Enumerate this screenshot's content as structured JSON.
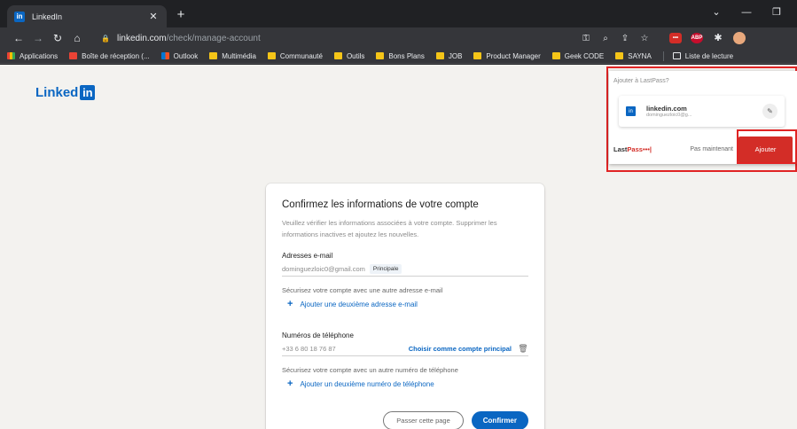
{
  "browser": {
    "tab_title": "LinkedIn",
    "tab_favicon": "in",
    "new_tab_symbol": "+",
    "url_host": "linkedin.com",
    "url_path": "/check/manage-account",
    "bookmarks": [
      {
        "label": "Applications",
        "icon": "apps"
      },
      {
        "label": "Boîte de réception (...",
        "icon": "gmail"
      },
      {
        "label": "Outlook",
        "icon": "outlook"
      },
      {
        "label": "Multimédia",
        "icon": "folder"
      },
      {
        "label": "Communauté",
        "icon": "folder"
      },
      {
        "label": "Outils",
        "icon": "folder"
      },
      {
        "label": "Bons Plans",
        "icon": "folder"
      },
      {
        "label": "JOB",
        "icon": "folder"
      },
      {
        "label": "Product Manager",
        "icon": "folder"
      },
      {
        "label": "Geek CODE",
        "icon": "folder"
      },
      {
        "label": "SAYNA",
        "icon": "folder"
      }
    ],
    "reading_list": "Liste de lecture"
  },
  "page": {
    "logo_text": "Linked",
    "logo_box": "in",
    "card": {
      "title": "Confirmez les informations de votre compte",
      "description": "Veuillez vérifier les informations associées à votre compte. Supprimer les informations inactives et ajoutez les nouvelles.",
      "email_section": {
        "label": "Adresses e-mail",
        "value": "dominguezloic0@gmail.com",
        "badge": "Principale",
        "helper": "Sécurisez votre compte avec une autre adresse e-mail",
        "add_link": "Ajouter une deuxième adresse e-mail"
      },
      "phone_section": {
        "label": "Numéros de téléphone",
        "value": "+33 6 80 18 76 87",
        "make_primary": "Choisir comme compte principal",
        "helper": "Sécurisez votre compte avec un autre numéro de téléphone",
        "add_link": "Ajouter un deuxième numéro de téléphone"
      },
      "skip_button": "Passer cette page",
      "confirm_button": "Confirmer"
    }
  },
  "lastpass": {
    "header": "Ajouter à LastPass?",
    "site_icon": "in",
    "site_domain": "linkedin.com",
    "site_user": "dominguezloic0@g...",
    "brand_last": "Last",
    "brand_pass": "Pass",
    "brand_dots": "•••|",
    "later_button": "Pas maintenant",
    "add_button": "Ajouter"
  },
  "colors": {
    "linkedin_blue": "#0a66c2",
    "lastpass_red": "#d32d27",
    "highlight_red": "#e02424"
  }
}
